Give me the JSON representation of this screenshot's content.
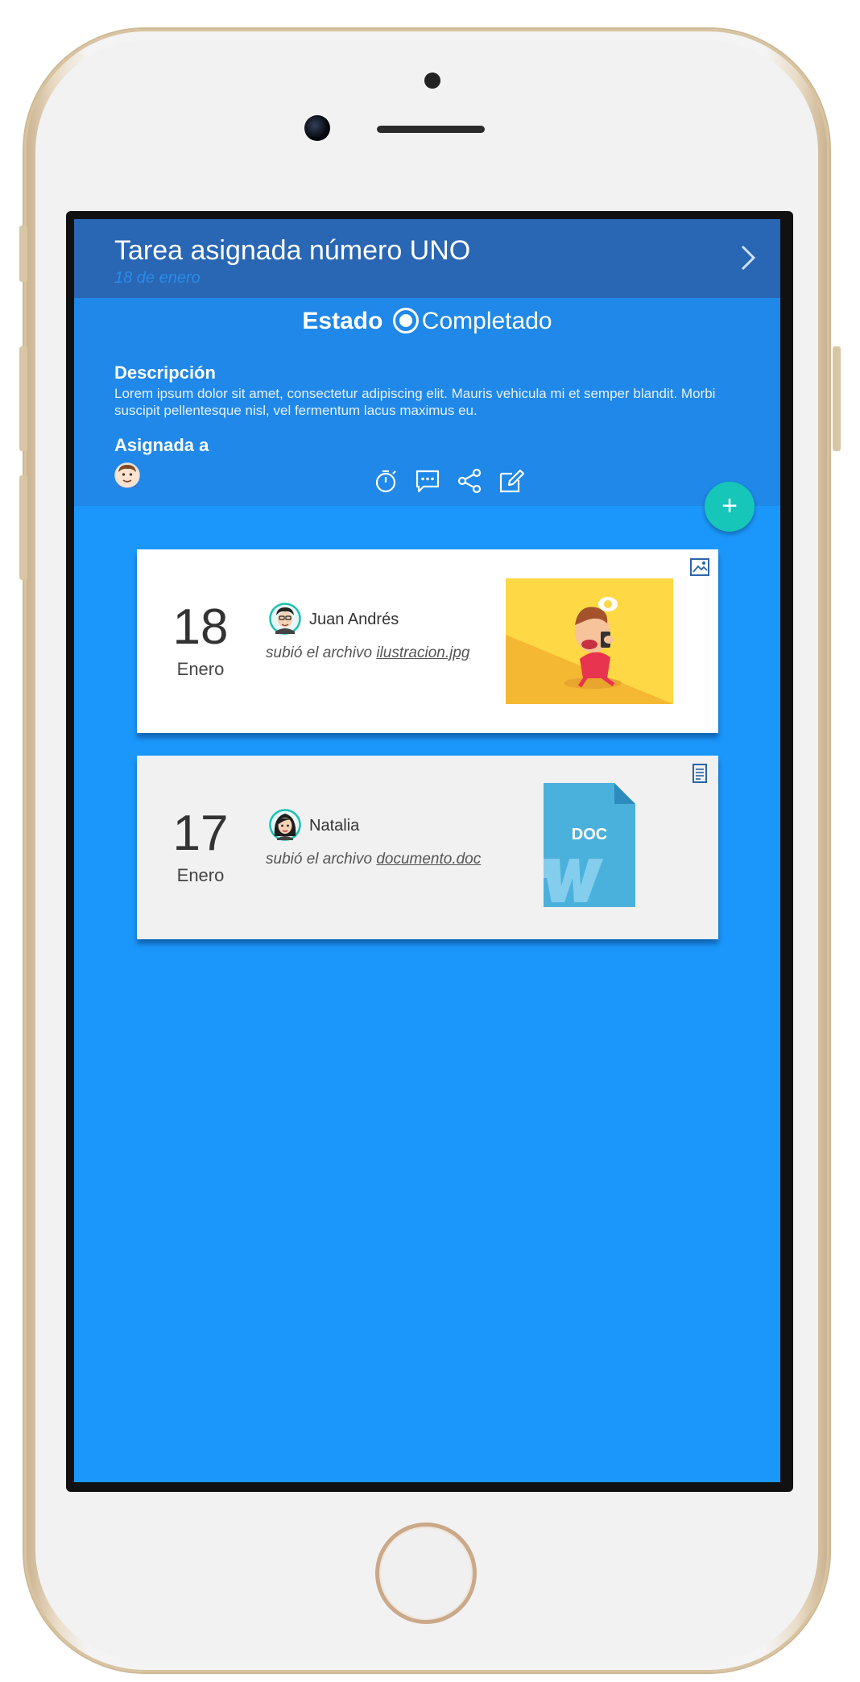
{
  "header": {
    "title": "Tarea asignada número UNO",
    "date": "18 de enero"
  },
  "status": {
    "label": "Estado",
    "value": "Completado"
  },
  "description": {
    "heading": "Descripción",
    "text": "Lorem ipsum dolor sit amet, consectetur adipiscing elit. Mauris vehicula mi et semper blandit. Morbi suscipit pellentesque nisl, vel fermentum lacus maximus eu."
  },
  "assigned": {
    "heading": "Asignada a"
  },
  "actions": [
    {
      "icon": "timer-icon"
    },
    {
      "icon": "comment-icon"
    },
    {
      "icon": "share-icon"
    },
    {
      "icon": "edit-icon"
    }
  ],
  "fab": {
    "label": "+"
  },
  "activity": [
    {
      "day": "18",
      "month": "Enero",
      "user": "Juan Andrés",
      "action": "subió el archivo",
      "file": "ilustracion.jpg",
      "type_icon": "image-icon"
    },
    {
      "day": "17",
      "month": "Enero",
      "user": "Natalia",
      "action": "subió el archivo",
      "file": "documento.doc",
      "type_icon": "document-icon",
      "doc_label": "DOC"
    }
  ],
  "colors": {
    "titlebar": "#2966b3",
    "info": "#1f88e8",
    "background": "#1b97fb",
    "fab": "#16c6b9"
  }
}
